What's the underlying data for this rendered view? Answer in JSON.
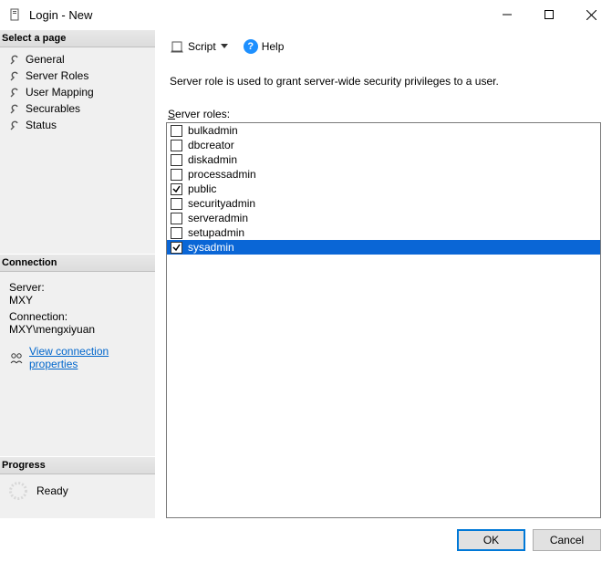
{
  "window": {
    "title": "Login - New"
  },
  "pages": {
    "header": "Select a page",
    "items": [
      {
        "label": "General"
      },
      {
        "label": "Server Roles"
      },
      {
        "label": "User Mapping"
      },
      {
        "label": "Securables"
      },
      {
        "label": "Status"
      }
    ]
  },
  "toolbar": {
    "script_label": "Script",
    "help_label": "Help"
  },
  "description": "Server role is used to grant server-wide security privileges to a user.",
  "roles": {
    "label_prefix": "S",
    "label_rest": "erver roles:",
    "items": [
      {
        "name": "bulkadmin",
        "checked": false,
        "selected": false
      },
      {
        "name": "dbcreator",
        "checked": false,
        "selected": false
      },
      {
        "name": "diskadmin",
        "checked": false,
        "selected": false
      },
      {
        "name": "processadmin",
        "checked": false,
        "selected": false
      },
      {
        "name": "public",
        "checked": true,
        "selected": false
      },
      {
        "name": "securityadmin",
        "checked": false,
        "selected": false
      },
      {
        "name": "serveradmin",
        "checked": false,
        "selected": false
      },
      {
        "name": "setupadmin",
        "checked": false,
        "selected": false
      },
      {
        "name": "sysadmin",
        "checked": true,
        "selected": true
      }
    ]
  },
  "connection": {
    "header": "Connection",
    "server_label": "Server:",
    "server_value": "MXY",
    "conn_label": "Connection:",
    "conn_value": "MXY\\mengxiyuan",
    "link": "View connection properties"
  },
  "progress": {
    "header": "Progress",
    "status": "Ready"
  },
  "buttons": {
    "ok": "OK",
    "cancel": "Cancel"
  }
}
